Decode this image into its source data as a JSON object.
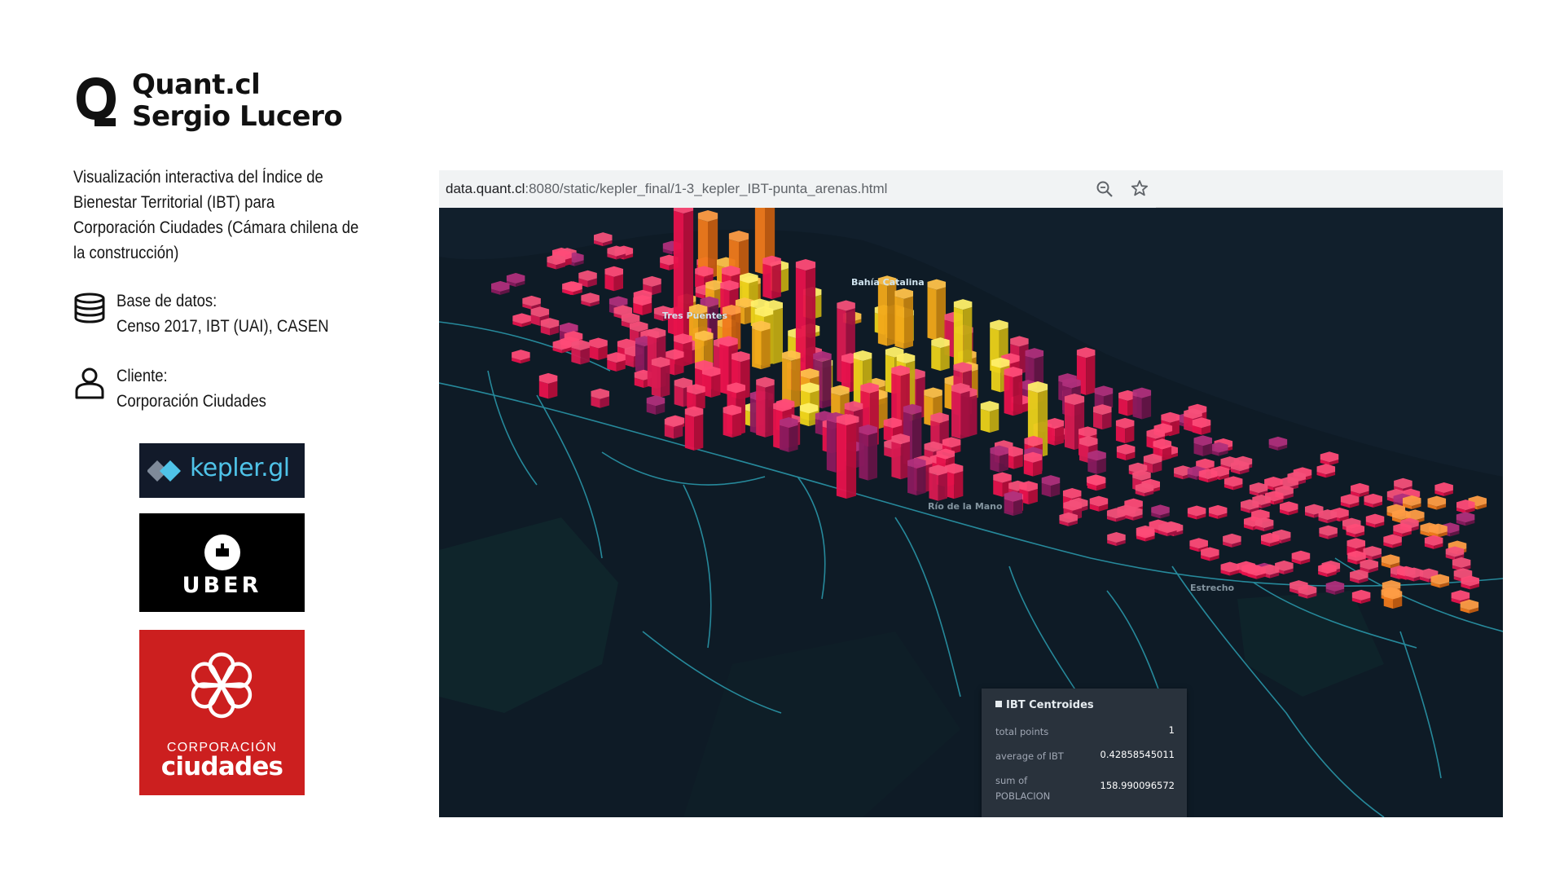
{
  "brand": {
    "name": "Quant.cl",
    "person": "Sergio Lucero"
  },
  "description": "Visualización interactiva del Índice de Bienestar Territorial (IBT) para Corporación Ciudades (Cámara chilena de la construcción)",
  "database": {
    "icon": "database-icon",
    "label": "Base de datos:",
    "value": "Censo 2017, IBT (UAI), CASEN"
  },
  "client": {
    "icon": "user-icon",
    "label": "Cliente:",
    "value": "Corporación Ciudades"
  },
  "logos": {
    "kepler": {
      "text": "kepler.gl",
      "color": "#4fc3e8"
    },
    "uber": {
      "text": "UBER"
    },
    "corporacion": {
      "top": "CORPORACIÓN",
      "bottom": "ciudades",
      "color": "#cc1f1f"
    }
  },
  "browser": {
    "url_host": "data.quant.cl",
    "url_path": ":8080/static/kepler_final/1-3_kepler_IBT-punta_arenas.html",
    "zoom_icon": "magnifier-icon",
    "star_icon": "star-icon"
  },
  "map": {
    "place_labels": [
      "Bahía Catalina",
      "Tres Puentes",
      "Río de la Mano",
      "Estrecho"
    ],
    "colors": {
      "background": "#0e1b26",
      "roads": "#2b9db0",
      "low": "#e8124c",
      "mid": "#f07a1c",
      "high": "#ecd21a"
    },
    "tooltip": {
      "title": "IBT Centroides",
      "rows": [
        {
          "key": "total points",
          "value": "1"
        },
        {
          "key": "average of IBT",
          "value": "0.42858545011"
        },
        {
          "key": "sum of POBLACION",
          "value": "158.990096572"
        }
      ]
    }
  }
}
